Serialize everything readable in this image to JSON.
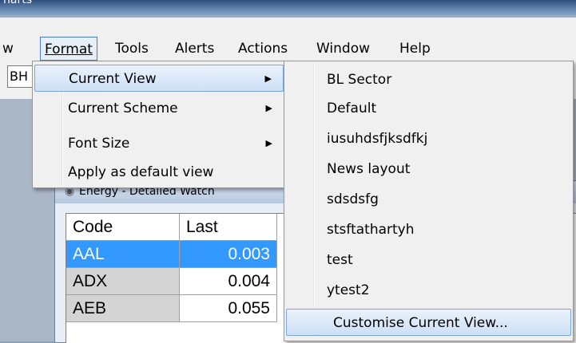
{
  "window": {
    "title": "harts"
  },
  "menubar": {
    "items": [
      {
        "label": "w"
      },
      {
        "label": "Format"
      },
      {
        "label": "Tools"
      },
      {
        "label": "Alerts"
      },
      {
        "label": "Actions"
      },
      {
        "label": "Window"
      },
      {
        "label": "Help"
      }
    ]
  },
  "toolbar": {
    "combo_value": "BH"
  },
  "format_menu": {
    "items": [
      {
        "label": "Current View"
      },
      {
        "label": "Current Scheme"
      },
      {
        "label": "Font Size"
      },
      {
        "label": "Apply as default view"
      }
    ]
  },
  "view_submenu": {
    "items": [
      {
        "label": "BL Sector"
      },
      {
        "label": "Default"
      },
      {
        "label": "iusuhdsfjksdfkj"
      },
      {
        "label": "News layout"
      },
      {
        "label": "sdsdsfg"
      },
      {
        "label": "stsftathartyh"
      },
      {
        "label": "test"
      },
      {
        "label": "ytest2"
      },
      {
        "label": "Customise Current View..."
      }
    ]
  },
  "watchlist": {
    "title": "Energy - Detailed Watch",
    "columns": {
      "code": "Code",
      "last": "Last"
    },
    "rows": [
      {
        "code": "AAL",
        "last": "0.003"
      },
      {
        "code": "ADX",
        "last": "0.004"
      },
      {
        "code": "AEB",
        "last": "0.055"
      }
    ]
  },
  "colors": {
    "selection": "#3399ff",
    "menu_bg": "#f0f0f0",
    "highlight_border": "#7aa7dc"
  }
}
